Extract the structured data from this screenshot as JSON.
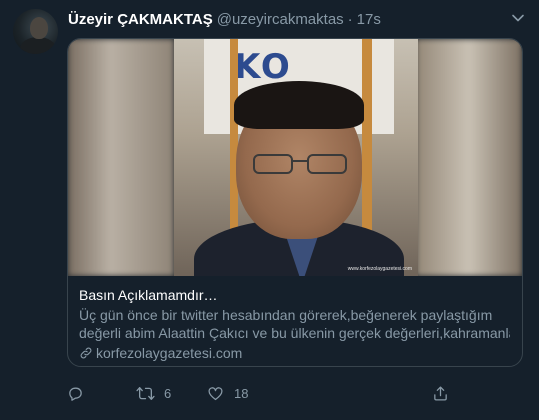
{
  "tweet": {
    "display_name": "Üzeyir ÇAKMAKTAŞ",
    "handle": "@uzeyircakmaktas",
    "separator": "·",
    "time": "17s"
  },
  "card": {
    "image_watermark": "www.korfezolaygazetesi.com",
    "title": "Basın Açıklamamdır…",
    "description_line1": "Üç gün önce bir twitter hesabından görerek,beğenerek paylaştığım",
    "description_line2": "değerli abim Alaattin Çakıcı ve bu ülkenin gerçek değerleri,kahramanları…",
    "domain": "korfezolaygazetesi.com"
  },
  "actions": {
    "reply_count": "",
    "retweet_count": "6",
    "like_count": "18"
  },
  "icons": {
    "caret": "chevron-down-icon",
    "link": "link-icon",
    "reply": "reply-icon",
    "retweet": "retweet-icon",
    "like": "heart-icon",
    "share": "share-icon"
  },
  "colors": {
    "background": "#15202b",
    "secondary_text": "#8899a6",
    "border": "#38444d"
  }
}
